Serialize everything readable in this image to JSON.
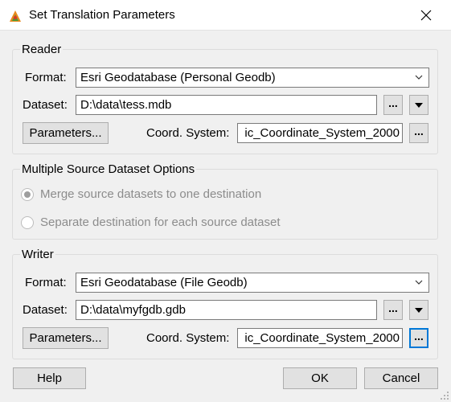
{
  "window": {
    "title": "Set Translation Parameters"
  },
  "reader": {
    "group_label": "Reader",
    "format_label": "Format:",
    "format_value": "Esri Geodatabase (Personal Geodb)",
    "dataset_label": "Dataset:",
    "dataset_value": "D:\\data\\tess.mdb",
    "browse_label": "...",
    "parameters_label": "Parameters...",
    "coord_label": "Coord. System:",
    "coord_value": "ic_Coordinate_System_2000",
    "coord_browse_label": "..."
  },
  "multi_source": {
    "group_label": "Multiple Source Dataset Options",
    "options": [
      {
        "label": "Merge source datasets to one destination",
        "selected": true,
        "enabled": false
      },
      {
        "label": "Separate destination for each source dataset",
        "selected": false,
        "enabled": false
      }
    ]
  },
  "writer": {
    "group_label": "Writer",
    "format_label": "Format:",
    "format_value": "Esri Geodatabase (File Geodb)",
    "dataset_label": "Dataset:",
    "dataset_value": "D:\\data\\myfgdb.gdb",
    "browse_label": "...",
    "parameters_label": "Parameters...",
    "coord_label": "Coord. System:",
    "coord_value": "ic_Coordinate_System_2000",
    "coord_browse_label": "..."
  },
  "footer": {
    "help_label": "Help",
    "ok_label": "OK",
    "cancel_label": "Cancel"
  },
  "colors": {
    "accent": "#0078d7",
    "button_face": "#e1e1e1",
    "dialog_bg": "#f0f0f0",
    "disabled_text": "#8c8c8c"
  },
  "icons": {
    "app": "fme-workbench-icon",
    "close": "close-icon",
    "dropdown": "chevron-down-icon"
  }
}
